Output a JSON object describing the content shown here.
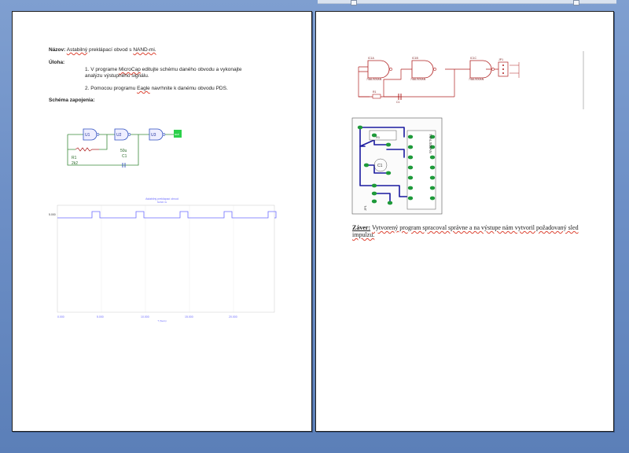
{
  "page1": {
    "nazov_label": "Názov:",
    "nazov_w1": "Astabilný",
    "nazov_w2": "preklápací obvod s",
    "nazov_w3": "NAND-mi.",
    "uloha_label": "Úloha:",
    "task1_a": "1. V programe",
    "task1_b": "MicroCap",
    "task1_c": "editujte schému daného obvodu a vykonajte",
    "task1_line2": "analýzu výstupného signálu.",
    "task2_a": "2. Pomocou programu",
    "task2_b": "Eagle",
    "task2_c": "navrhnite k danému obvodu PDS.",
    "schema_label": "Schéma zapojenia:",
    "schematic": {
      "gates": [
        "U1",
        "U2",
        "U3"
      ],
      "output_label": "out",
      "r_label": "R1",
      "r_value": "2k2",
      "c_label": "C1",
      "c_value": "50u"
    },
    "graph": {
      "title": "Astabilný preklápací obvod",
      "subtitle": "NAND 3x",
      "y_label": "5.000",
      "x_ticks": [
        "0.000",
        "5.000",
        "10.000",
        "15.000",
        "20.000"
      ],
      "x_label": "T (Secs)",
      "color_signal": "#6b6bff"
    }
  },
  "page2": {
    "schematic": {
      "gates": [
        {
          "id": "IC1A",
          "part": "74ALS00AN"
        },
        {
          "id": "IC1B",
          "part": "74ALS00AN"
        },
        {
          "id": "IC1C",
          "part": "74ALS00AN"
        }
      ],
      "connector": "JP1",
      "r_label": "R1",
      "c_label": "C1"
    },
    "pcb": {
      "ic_label": "74ALS00AN",
      "cap_label": "C1",
      "res_label": "R1",
      "jp_label": "JP1",
      "copper_color": "#1a1aa0",
      "pad_color": "#1e9a3a"
    },
    "zaver_label": "Záver:",
    "zaver_text": "Vytvorený program spracoval správne a na výstupe nám vytvoril požadovaný sled",
    "zaver_line2": "impulzu."
  },
  "colors": {
    "background": "#6d8fc6",
    "wire_green": "#3a8a3a",
    "schematic_red": "#b02020"
  }
}
